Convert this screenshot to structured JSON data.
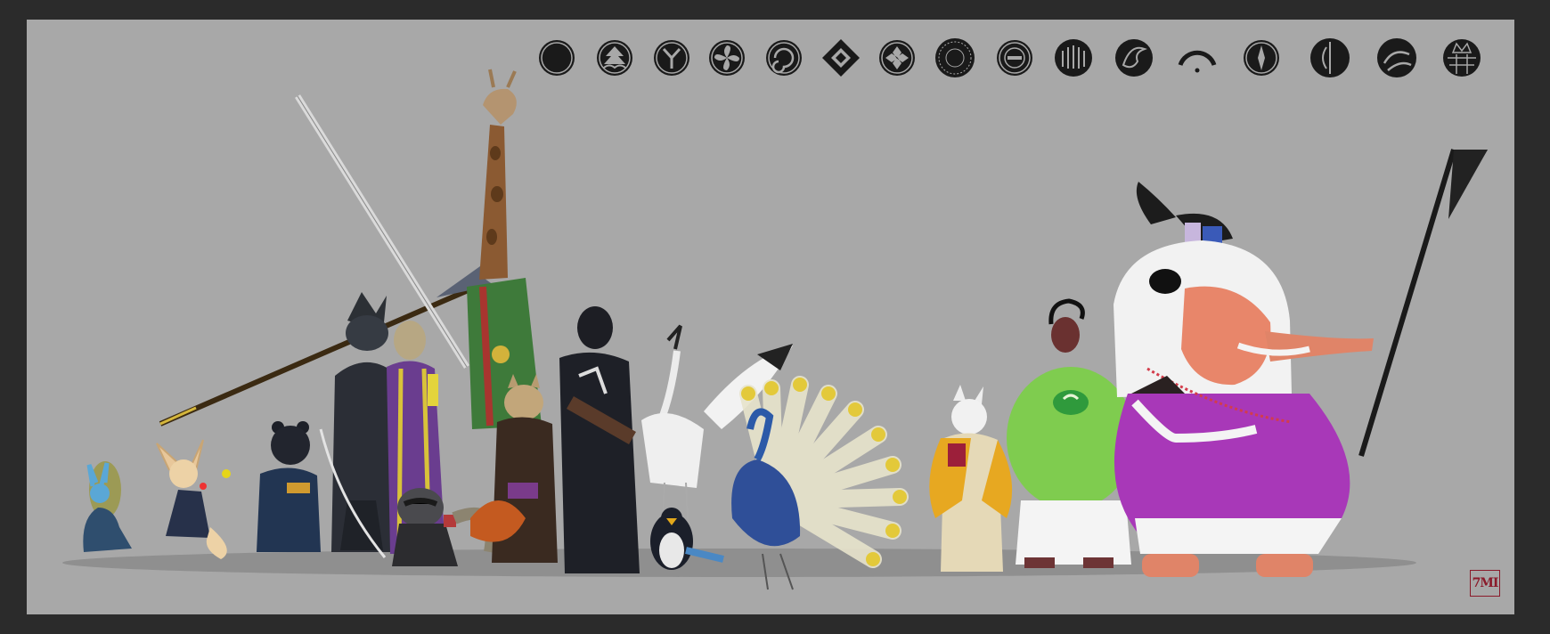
{
  "artwork": {
    "signature": "7MI",
    "background_color": "#a8a8a8",
    "frame_color": "#2b2b2b",
    "crest_count": 16,
    "crest_icons": [
      "crescent-crest-icon",
      "pine-wave-crest-icon",
      "three-branch-crest-icon",
      "pinwheel-crest-icon",
      "swirl-crest-icon",
      "diamond-crest-icon",
      "four-diamonds-crest-icon",
      "sun-rays-crest-icon",
      "concentric-crest-icon",
      "comb-crest-icon",
      "crane-crest-icon",
      "arc-crest-icon",
      "compass-crest-icon",
      "split-leaf-crest-icon",
      "tomoe-crest-icon",
      "crown-crest-icon"
    ],
    "characters": [
      "rabbit-samurai",
      "fennec-fox-samurai",
      "bear-samurai",
      "wolf-spearman",
      "tall-cat-ronin",
      "raccoon-samurai",
      "giraffe-samurai",
      "lynx-samurai",
      "panther-ronin",
      "crane-samurai",
      "penguin-samurai",
      "peacock-samurai",
      "white-wolf-samurai",
      "turtle-samurai",
      "magpie-rider",
      "elephant-warrior"
    ]
  }
}
